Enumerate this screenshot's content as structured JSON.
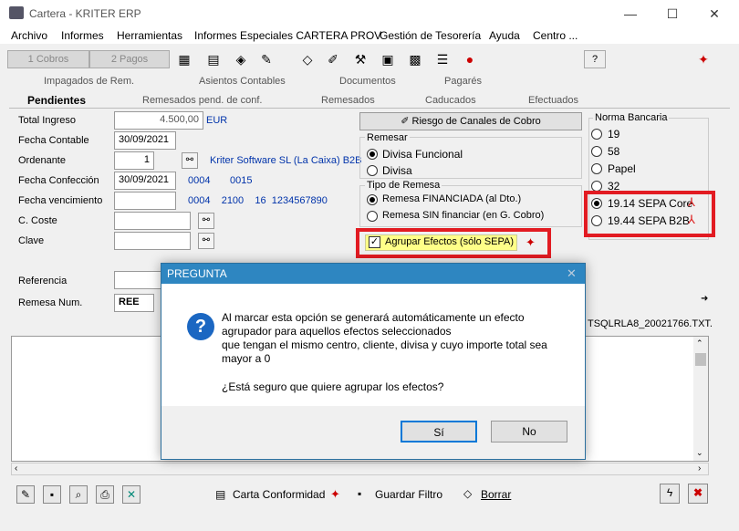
{
  "window": {
    "title": "Cartera - KRITER ERP",
    "minimize": "—",
    "maximize": "☐",
    "close": "✕"
  },
  "menu": [
    "Archivo",
    "Informes",
    "Herramientas",
    "Informes Especiales CARTERA PROV",
    "Gestión de Tesorería",
    "Ayuda",
    "Centro ..."
  ],
  "toolbar": {
    "cobros": "1 Cobros",
    "pagos": "2 Pagos",
    "help": "?"
  },
  "tabs_row1": [
    "Impagados de Rem.",
    "Asientos Contables",
    "Documentos",
    "Pagarés"
  ],
  "tabs_row2": [
    "Pendientes",
    "Remesados pend. de conf.",
    "Remesados",
    "Caducados",
    "Efectuados"
  ],
  "form": {
    "total_ingreso_label": "Total Ingreso",
    "total_ingreso": "4.500,00",
    "currency": "EUR",
    "fecha_contable_label": "Fecha Contable",
    "fecha_contable": "30/09/2021",
    "ordenante_label": "Ordenante",
    "ordenante": "1",
    "ordenante_name": "Kriter Software SL (La Caixa) B2B",
    "fecha_confeccion_label": "Fecha Confección",
    "fecha_confeccion": "30/09/2021",
    "bank1": "0004",
    "bank2": "0015",
    "fecha_venc_label": "Fecha vencimiento",
    "iban_parts": "0004    2100    16  1234567890",
    "coste_label": "C. Coste",
    "clave_label": "Clave",
    "referencia_label": "Referencia",
    "remesa_label": "Remesa Num.",
    "remesa_value": "REE",
    "file_name": "TSQLRLA8_20021766.TXT."
  },
  "riesgo_button": "Riesgo de Canales de Cobro",
  "remesar": {
    "title": "Remesar",
    "options": [
      "Divisa Funcional",
      "Divisa"
    ],
    "selected": "Divisa Funcional"
  },
  "tipo_remesa": {
    "title": "Tipo de Remesa",
    "options": [
      "Remesa FINANCIADA (al Dto.)",
      "Remesa SIN financiar (en G. Cobro)"
    ],
    "selected": "Remesa FINANCIADA (al Dto.)"
  },
  "agrupar": {
    "label": "Agrupar Efectos (sólo SEPA)",
    "checked": true
  },
  "norma": {
    "title": "Norma Bancaria",
    "options": [
      "19",
      "58",
      "Papel",
      "32",
      "19.14 SEPA Core",
      "19.44 SEPA B2B"
    ],
    "selected": "19.14 SEPA Core"
  },
  "dialog": {
    "title": "PREGUNTA",
    "line1": "Al marcar esta opción se generará automáticamente un efecto",
    "line2": "agrupador para aquellos efectos seleccionados",
    "line3": "que tengan el mismo centro, cliente, divisa y cuyo importe total sea",
    "line4": "mayor a 0",
    "question": "¿Está seguro que quiere agrupar los efectos?",
    "yes": "Sí",
    "no": "No"
  },
  "bottom": {
    "carta": "Carta Conformidad",
    "guardar": "Guardar Filtro",
    "borrar": "Borrar"
  },
  "colors": {
    "accent": "#2e86c1",
    "highlight": "#e21b22",
    "link": "#0033aa"
  }
}
